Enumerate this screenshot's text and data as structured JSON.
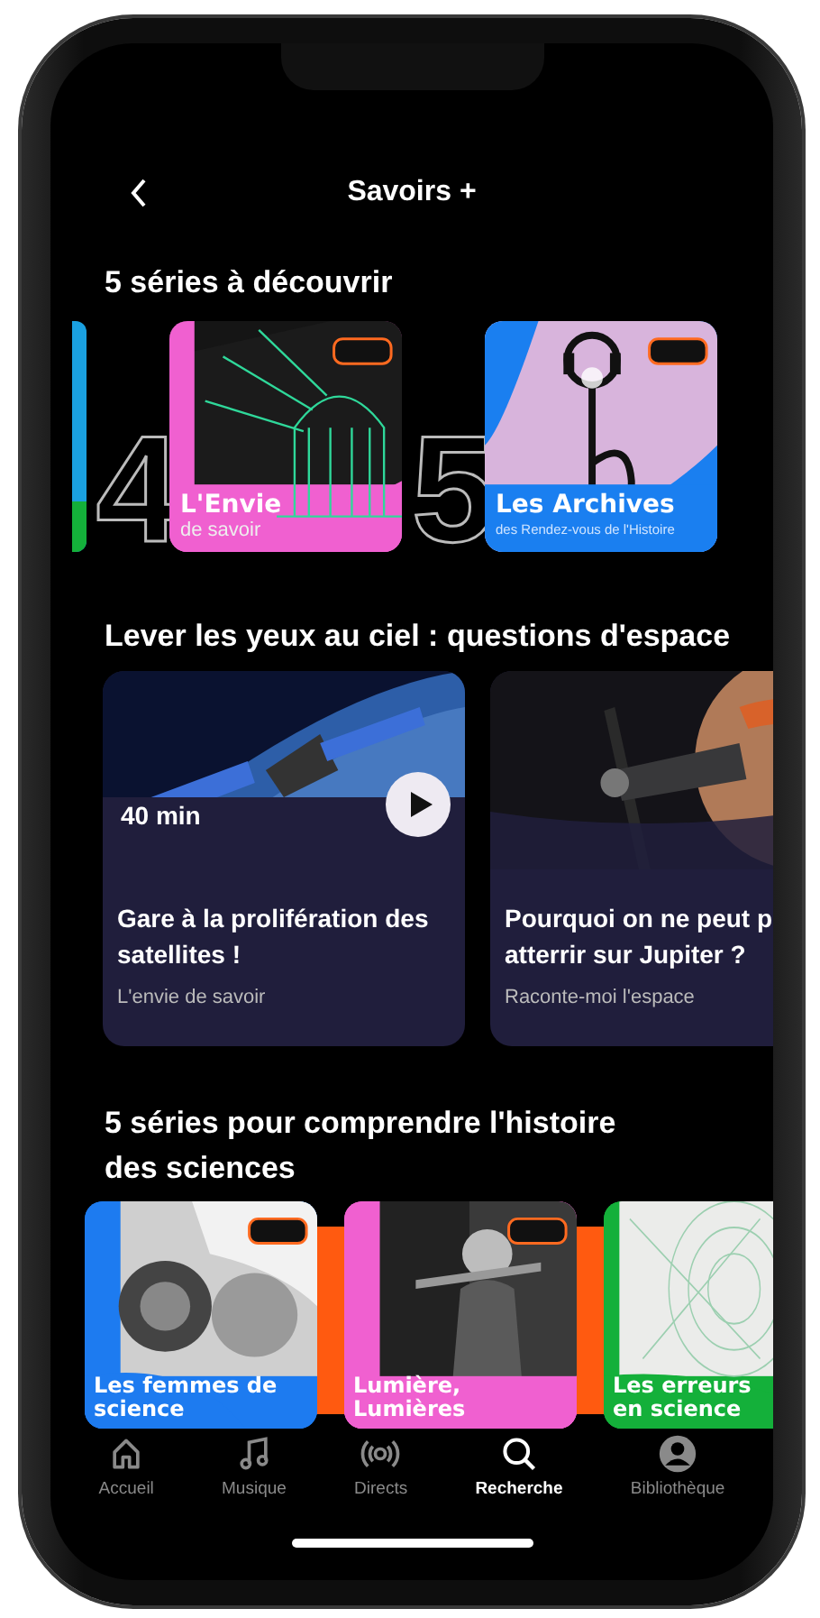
{
  "header": {
    "title": "Savoirs +"
  },
  "sections": [
    {
      "kind": "ranked",
      "title": "5 séries à découvrir",
      "items": [
        {
          "kind": "picture",
          "color": "#1aa0e0"
        },
        {
          "rank": "4",
          "title": "L'Envie",
          "subtitle": "de savoir",
          "color": "#f060d0"
        },
        {
          "rank": "5",
          "title": "Les Archives",
          "subtitle": "des Rendez-vous de l'Histoire",
          "color": "#1a7ff0"
        }
      ]
    },
    {
      "kind": "episodes",
      "title": "Lever les yeux au ciel : questions d'espace",
      "items": [
        {
          "title_lines": [
            "Gare à la prolifération des",
            "satellites !"
          ],
          "show": "L'envie de savoir",
          "duration": "40 min",
          "playable": true
        },
        {
          "title_lines": [
            "Pourquoi on ne peut p",
            "atterrir sur Jupiter ?"
          ],
          "show": "Raconte-moi l'espace",
          "playable": false
        }
      ]
    },
    {
      "kind": "covers",
      "title": "5 séries pour comprendre l'histoire des sciences",
      "items": [
        {
          "title": "Les femmes de science",
          "color": "#1d7bf0"
        },
        {
          "title": "Lumière, Lumières",
          "color": "#f060d0"
        },
        {
          "title": "Les erreurs en science",
          "color": "#14b03a"
        }
      ]
    }
  ],
  "tabs": [
    {
      "label": "Accueil",
      "selected": false
    },
    {
      "label": "Musique",
      "selected": false
    },
    {
      "label": "Directs",
      "selected": false
    },
    {
      "label": "Recherche",
      "selected": true
    },
    {
      "label": "Bibliothèque",
      "selected": false
    }
  ]
}
